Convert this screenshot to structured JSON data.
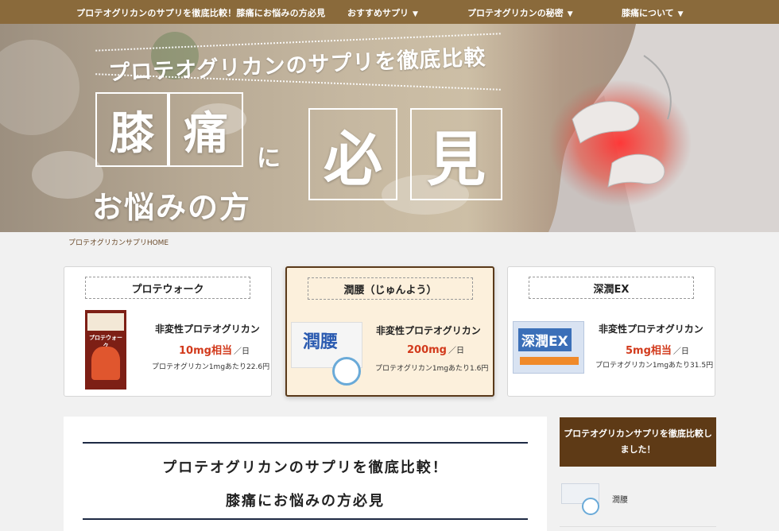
{
  "nav": {
    "site_title": "プロテオグリカンのサプリを徹底比較！膝痛にお悩みの方必見",
    "menu": [
      {
        "label": "おすすめサプリ",
        "arrow": "▼"
      },
      {
        "label": "プロテオグリカンの秘密",
        "arrow": "▼"
      },
      {
        "label": "膝痛について",
        "arrow": "▼"
      }
    ]
  },
  "hero": {
    "tagline": "プロテオグリカンのサプリを徹底比較",
    "chars": [
      "膝",
      "痛",
      "必",
      "見"
    ],
    "ni": "に",
    "line2": "お悩みの方"
  },
  "breadcrumb": "プロテオグリカンサプリHOME",
  "products": [
    {
      "name": "プロテウォーク",
      "type": "非変性プロテオグリカン",
      "dose": "10mg相当",
      "per": "／日",
      "price": "プロテオグリカン1mgあたり22.6円",
      "package_text": "プロテウォーク"
    },
    {
      "name": "潤腰（じゅんよう）",
      "type": "非変性プロテオグリカン",
      "dose": "200mg",
      "per": "／日",
      "price": "プロテオグリカン1mgあたり1.6円",
      "package_text": "潤腰"
    },
    {
      "name": "深潤EX",
      "type": "非変性プロテオグリカン",
      "dose": "5mg相当",
      "per": "／日",
      "price": "プロテオグリカン1mgあたり31.5円",
      "package_text": "深潤EX"
    }
  ],
  "article": {
    "title_line1": "プロテオグリカンのサプリを徹底比較！",
    "title_line2": "膝痛にお悩みの方必見"
  },
  "sidebar": {
    "heading": "プロテオグリカンサプリを徹底比較しました！",
    "items": [
      {
        "label": "潤腰"
      }
    ]
  },
  "colors": {
    "nav_bg": "#8a6a3b",
    "accent_red": "#d23a1c",
    "sidebar_head_bg": "#5e3a16",
    "featured_bg": "#fcf0dc"
  }
}
